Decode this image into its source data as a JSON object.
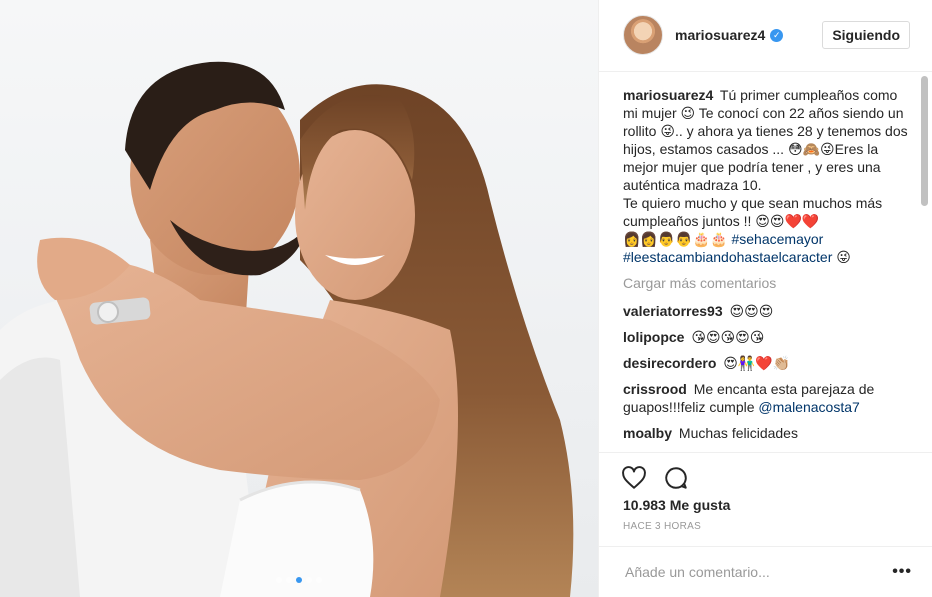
{
  "post": {
    "username": "mariosuarez4",
    "follow_label": "Siguiendo",
    "caption_user": "mariosuarez4",
    "caption_text": "Tú primer cumpleaños como mi mujer 😉 Te conocí con 22 años siendo un rollito 😜.. y ahora ya tienes 28 y tenemos dos hijos, estamos casados ... 😳🙈😜Eres la mejor mujer que podría tener , y eres una auténtica madraza 10.",
    "caption_text2": "Te quiero mucho y que sean muchos más cumpleaños juntos !! 😍😍❤️❤️",
    "caption_emoji_line": "👩👩👨👨🎂🎂",
    "hashtag1": "#sehacemayor",
    "hashtag2": "#leestacambiandohastaelcaracter",
    "hashtag2_emoji": "😜",
    "load_more": "Cargar más comentarios",
    "comments": [
      {
        "user": "valeriatorres93",
        "text": "😍😍😍"
      },
      {
        "user": "lolipopce",
        "text": "😘😍😘😍😘"
      },
      {
        "user": "desirecordero",
        "text": "😍👫❤️👏🏼"
      },
      {
        "user": "crissrood",
        "text": "Me encanta esta parejaza de guapos!!!feliz cumple ",
        "mention": "@malenacosta7"
      },
      {
        "user": "moalby",
        "text": "Muchas felicidades"
      }
    ],
    "likes": "10.983 Me gusta",
    "time": "HACE 3 HORAS",
    "comment_placeholder": "Añade un comentario...",
    "options": "•••"
  },
  "icons": {
    "like": "heart-icon",
    "comment": "comment-bubble-icon",
    "verified": "verified-badge-icon"
  },
  "colors": {
    "link": "#003569",
    "verified": "#3897f0",
    "muted": "#999999"
  }
}
